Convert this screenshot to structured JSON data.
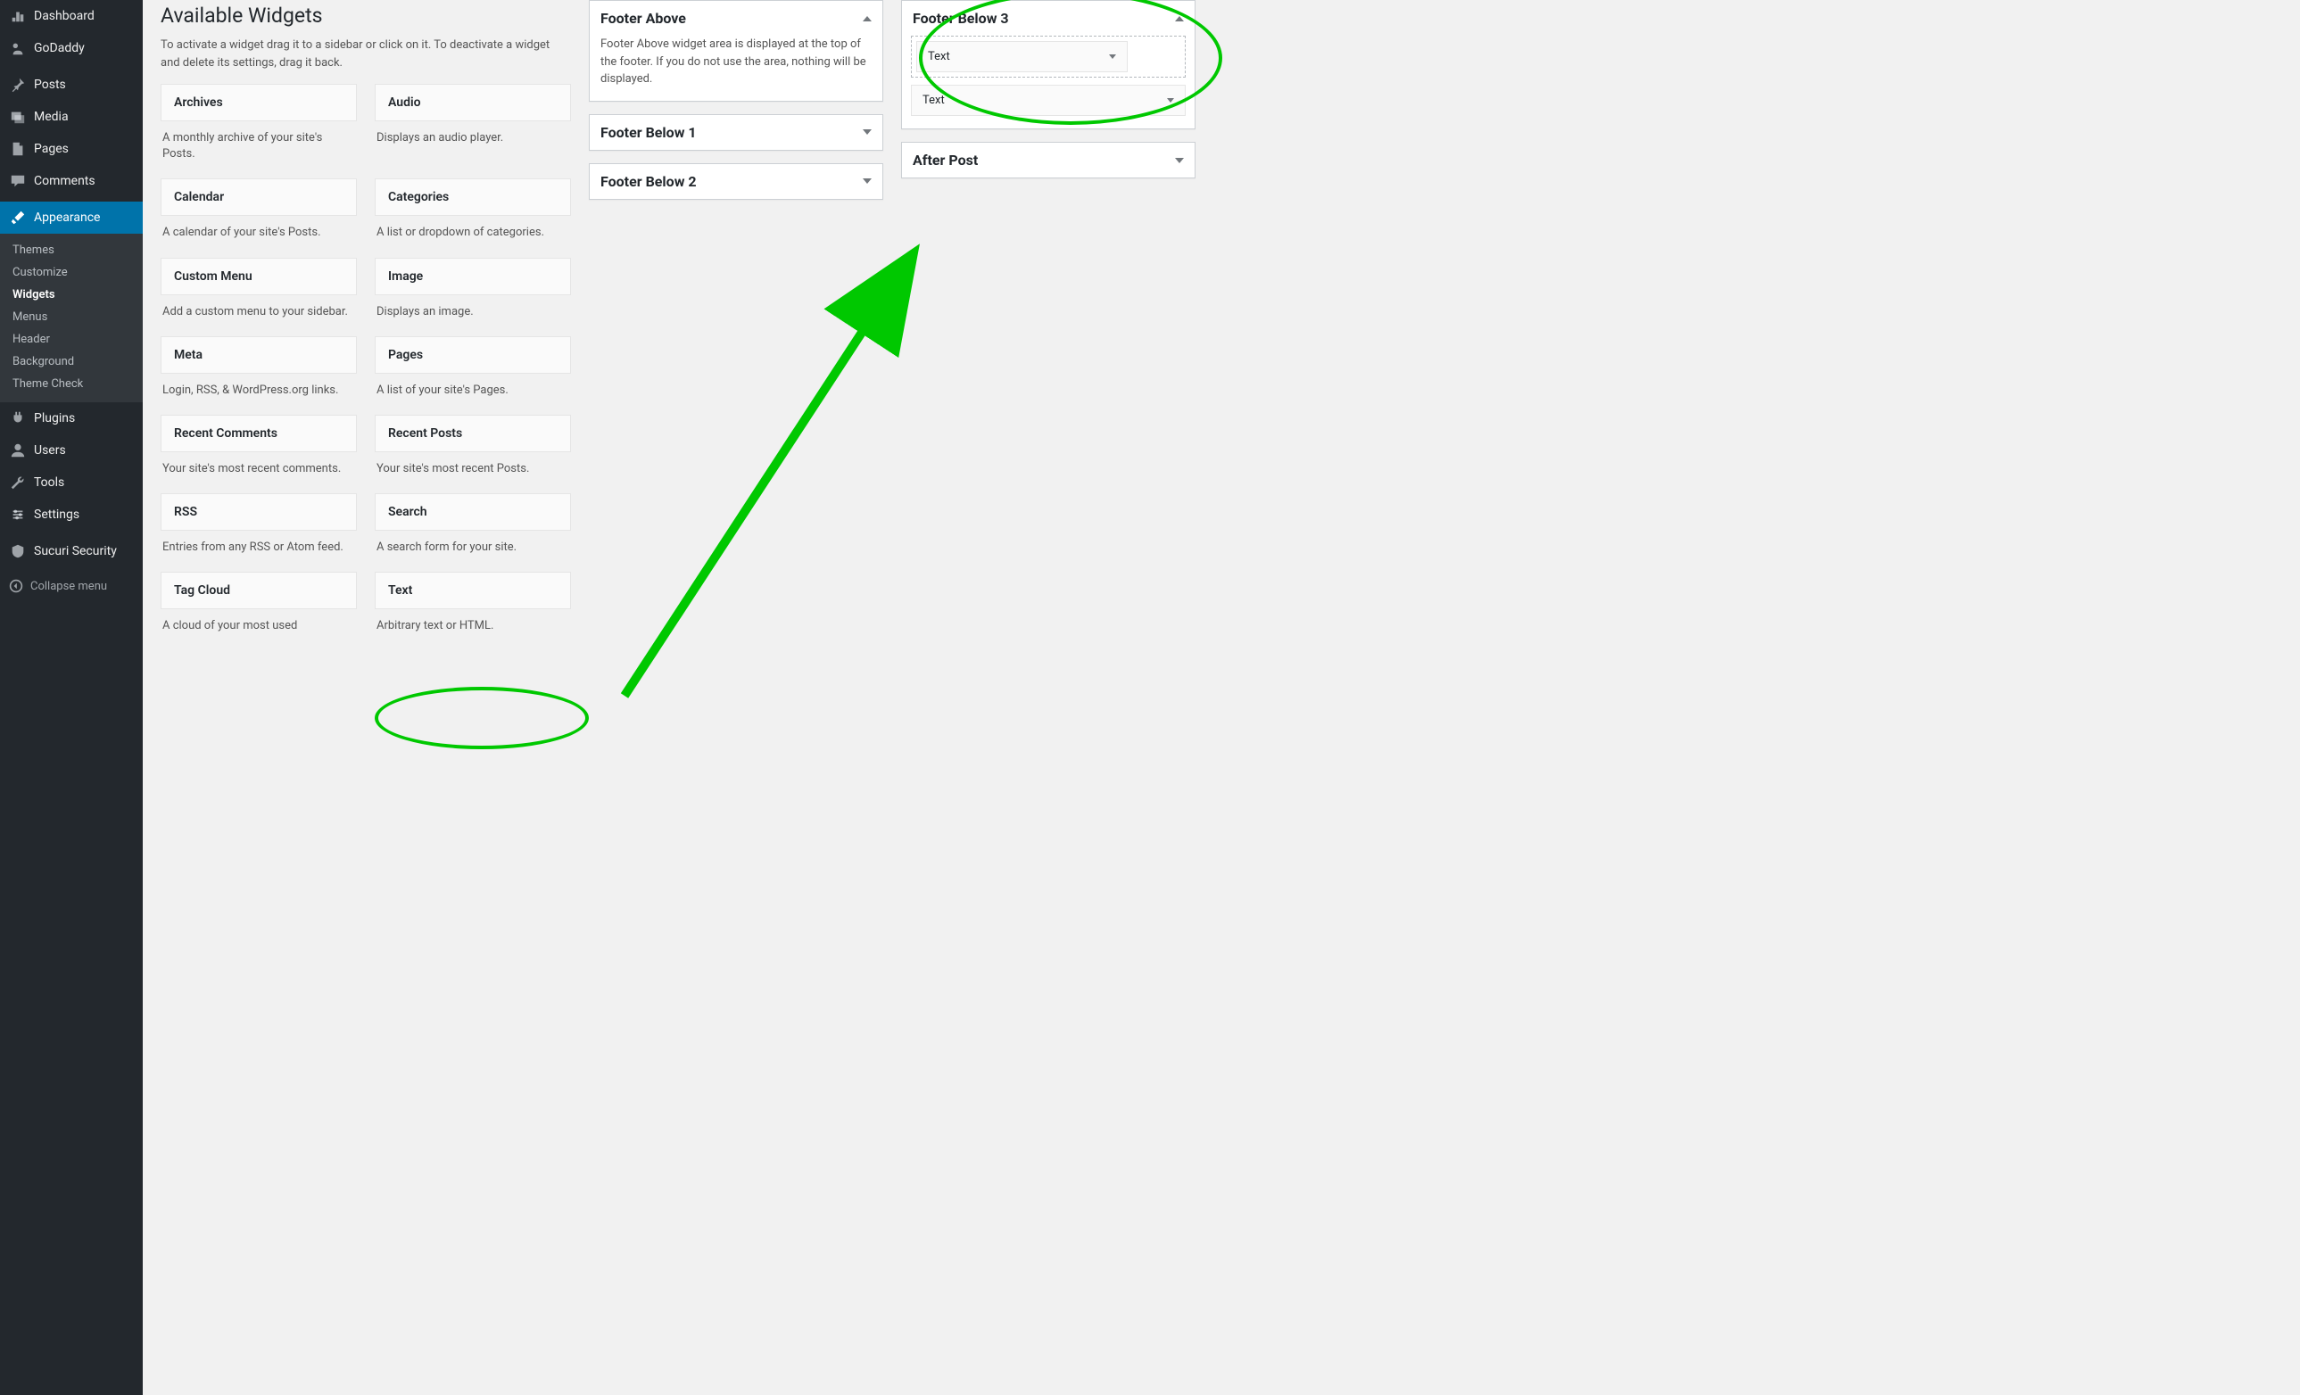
{
  "sidebar": {
    "items": [
      {
        "id": "dashboard",
        "label": "Dashboard",
        "icon": "dashboard-icon"
      },
      {
        "id": "godaddy",
        "label": "GoDaddy",
        "icon": "godaddy-icon"
      },
      {
        "id": "posts",
        "label": "Posts",
        "icon": "pin-icon"
      },
      {
        "id": "media",
        "label": "Media",
        "icon": "media-icon"
      },
      {
        "id": "pages",
        "label": "Pages",
        "icon": "page-icon"
      },
      {
        "id": "comments",
        "label": "Comments",
        "icon": "comment-icon"
      },
      {
        "id": "appearance",
        "label": "Appearance",
        "icon": "brush-icon",
        "current": true
      },
      {
        "id": "plugins",
        "label": "Plugins",
        "icon": "plug-icon"
      },
      {
        "id": "users",
        "label": "Users",
        "icon": "user-icon"
      },
      {
        "id": "tools",
        "label": "Tools",
        "icon": "wrench-icon"
      },
      {
        "id": "settings",
        "label": "Settings",
        "icon": "settings-icon"
      },
      {
        "id": "sucuri",
        "label": "Sucuri Security",
        "icon": "shield-icon"
      }
    ],
    "appearance_sub": [
      {
        "id": "themes",
        "label": "Themes"
      },
      {
        "id": "customize",
        "label": "Customize"
      },
      {
        "id": "widgets",
        "label": "Widgets",
        "current": true
      },
      {
        "id": "menus",
        "label": "Menus"
      },
      {
        "id": "header",
        "label": "Header"
      },
      {
        "id": "background",
        "label": "Background"
      },
      {
        "id": "themecheck",
        "label": "Theme Check"
      }
    ],
    "collapse_label": "Collapse menu"
  },
  "available": {
    "heading": "Available Widgets",
    "description": "To activate a widget drag it to a sidebar or click on it. To deactivate a widget and delete its settings, drag it back.",
    "widgets": [
      {
        "name": "Archives",
        "desc": "A monthly archive of your site's Posts."
      },
      {
        "name": "Audio",
        "desc": "Displays an audio player."
      },
      {
        "name": "Calendar",
        "desc": "A calendar of your site's Posts."
      },
      {
        "name": "Categories",
        "desc": "A list or dropdown of categories."
      },
      {
        "name": "Custom Menu",
        "desc": "Add a custom menu to your sidebar."
      },
      {
        "name": "Image",
        "desc": "Displays an image."
      },
      {
        "name": "Meta",
        "desc": "Login, RSS, & WordPress.org links."
      },
      {
        "name": "Pages",
        "desc": "A list of your site's Pages."
      },
      {
        "name": "Recent Comments",
        "desc": "Your site's most recent comments."
      },
      {
        "name": "Recent Posts",
        "desc": "Your site's most recent Posts."
      },
      {
        "name": "RSS",
        "desc": "Entries from any RSS or Atom feed."
      },
      {
        "name": "Search",
        "desc": "A search form for your site."
      },
      {
        "name": "Tag Cloud",
        "desc": "A cloud of your most used"
      },
      {
        "name": "Text",
        "desc": "Arbitrary text or HTML."
      }
    ]
  },
  "areas_col1": [
    {
      "id": "footer-above",
      "title": "Footer Above",
      "expanded": true,
      "desc": "Footer Above widget area is displayed at the top of the footer. If you do not use the area, nothing will be displayed."
    },
    {
      "id": "footer-below-1",
      "title": "Footer Below 1",
      "expanded": false
    },
    {
      "id": "footer-below-2",
      "title": "Footer Below 2",
      "expanded": false
    }
  ],
  "areas_col2": [
    {
      "id": "footer-below-3",
      "title": "Footer Below 3",
      "expanded": true,
      "drop_widget": "Text",
      "widgets": [
        {
          "name": "Text"
        }
      ]
    },
    {
      "id": "after-post",
      "title": "After Post",
      "expanded": false
    }
  ]
}
